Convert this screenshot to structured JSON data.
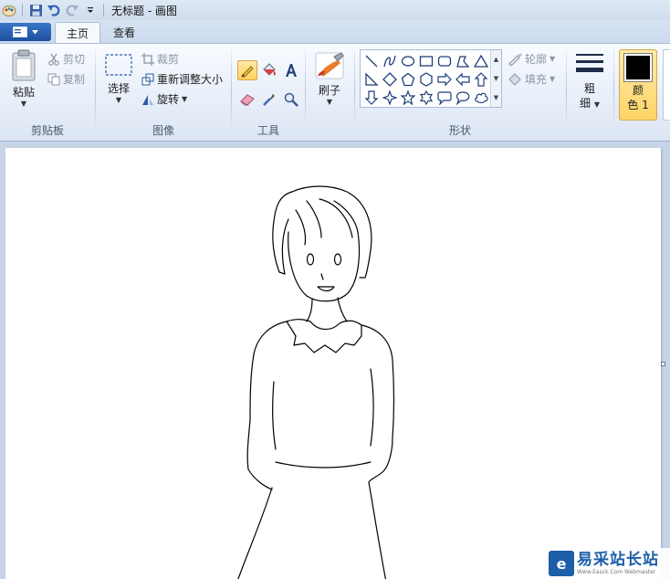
{
  "window": {
    "title": "无标题 - 画图"
  },
  "tabs": {
    "home": "主页",
    "view": "查看"
  },
  "clipboard": {
    "paste": "粘贴",
    "cut": "剪切",
    "copy": "复制",
    "group": "剪贴板"
  },
  "image": {
    "select": "选择",
    "crop": "裁剪",
    "resize": "重新调整大小",
    "rotate": "旋转",
    "group": "图像"
  },
  "tools": {
    "group": "工具",
    "brushes": "刷子"
  },
  "shapes": {
    "outline": "轮廓",
    "fill": "填充",
    "group": "形状"
  },
  "size": {
    "line1": "粗",
    "line2": "细"
  },
  "colors": {
    "color1_line1": "颜",
    "color1_line2": "色 1",
    "color1_value": "#000000"
  },
  "watermark": {
    "name": "易采站长站",
    "sub": "Www.Easck.Com Webmaster"
  }
}
